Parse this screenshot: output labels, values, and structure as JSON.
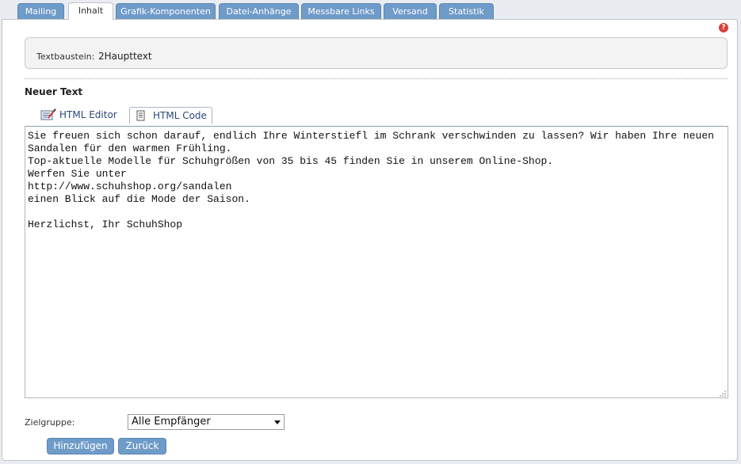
{
  "tabs": [
    {
      "label": "Mailing"
    },
    {
      "label": "Inhalt"
    },
    {
      "label": "Grafik-Komponenten"
    },
    {
      "label": "Datei-Anhänge"
    },
    {
      "label": "Messbare Links"
    },
    {
      "label": "Versand"
    },
    {
      "label": "Statistik"
    }
  ],
  "active_tab": "Inhalt",
  "help_glyph": "?",
  "textbaustein": {
    "label": "Textbaustein:",
    "value": "2Haupttext"
  },
  "section_title": "Neuer Text",
  "editor_tabs": [
    {
      "label": "HTML Editor",
      "icon": "html-editor-icon"
    },
    {
      "label": "HTML Code",
      "icon": "html-code-icon"
    }
  ],
  "active_editor_tab": "HTML Code",
  "code_text": "Sie freuen sich schon darauf, endlich Ihre Winterstiefl im Schrank verschwinden zu lassen? Wir haben Ihre neuen Sandalen für den warmen Frühling.\nTop-aktuelle Modelle für Schuhgrößen von 35 bis 45 finden Sie in unserem Online-Shop.\nWerfen Sie unter\nhttp://www.schuhshop.org/sandalen\neinen Blick auf die Mode der Saison.\n\nHerzlichst, Ihr SchuhShop",
  "zielgruppe": {
    "label": "Zielgruppe:",
    "selected": "Alle Empfänger"
  },
  "buttons": {
    "add": "Hinzufügen",
    "back": "Zurück"
  },
  "colors": {
    "tab_blue": "#6f9bc9",
    "help_red": "#d9403d"
  }
}
